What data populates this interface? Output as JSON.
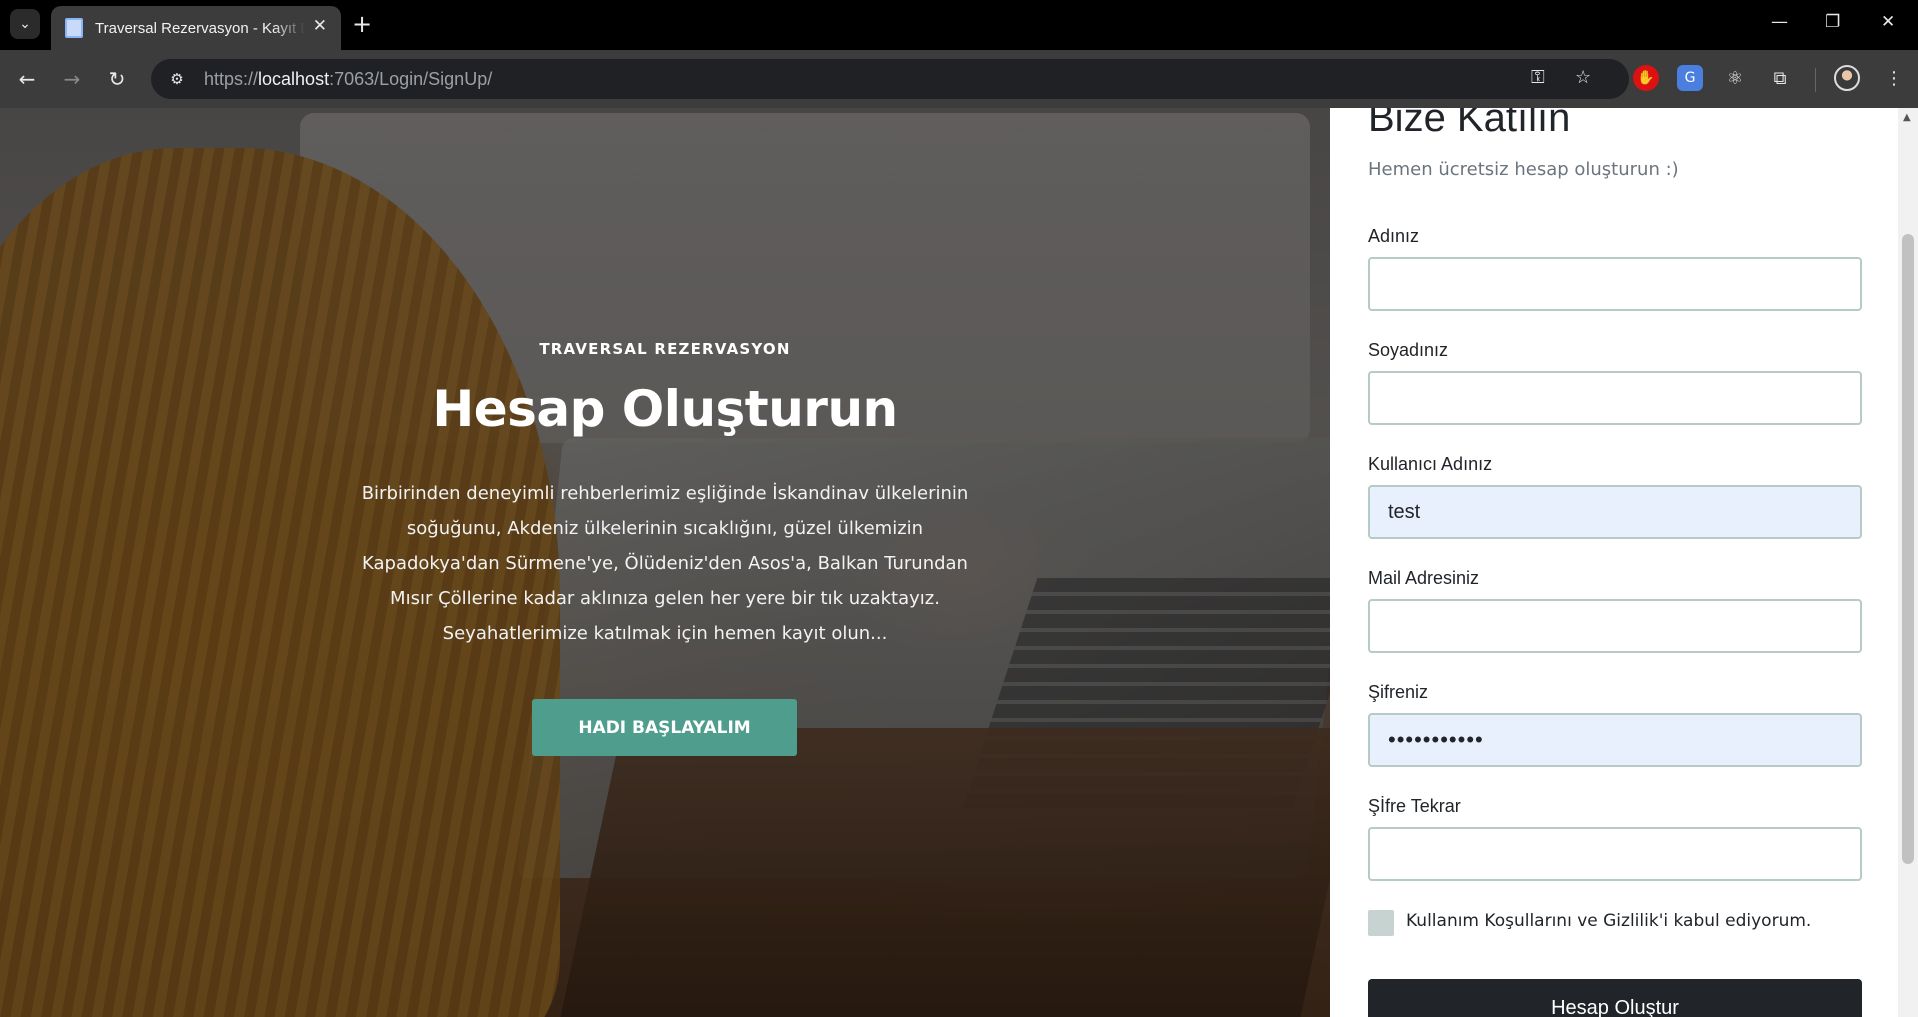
{
  "browser": {
    "tab_title": "Traversal Rezervasyon - Kayıt Ekle",
    "tab_close": "✕",
    "new_tab": "+",
    "url_prefix": "https://",
    "url_host": "localhost",
    "url_rest": ":7063/Login/SignUp/",
    "window": {
      "minimize": "—",
      "restore": "❐",
      "close": "✕"
    },
    "icons": [
      "tab-search-icon",
      "back-icon",
      "forward-icon",
      "reload-icon",
      "site-info-icon",
      "password-key-icon",
      "bookmark-star-icon",
      "extension-red-icon",
      "translate-icon",
      "react-devtools-icon",
      "extensions-puzzle-icon",
      "profile-avatar-icon",
      "menu-kebab-icon"
    ]
  },
  "hero": {
    "kicker": "TRAVERSAL REZERVASYON",
    "title": "Hesap Oluşturun",
    "description": "Birbirinden deneyimli rehberlerimiz eşliğinde İskandinav ülkelerinin soğuğunu, Akdeniz ülkelerinin sıcaklığını, güzel ülkemizin Kapadokya'dan Sürmene'ye, Ölüdeniz'den Asos'a, Balkan Turundan Mısır Çöllerine kadar aklınıza gelen her yere bir tık uzaktayız. Seyahatlerimize katılmak için hemen kayıt olun...",
    "button": "HADI BAŞLAYALIM"
  },
  "form": {
    "title": "Bize Katılın",
    "subtitle": "Hemen ücretsiz hesap oluşturun :)",
    "fields": [
      {
        "label": "Adınız",
        "value": ""
      },
      {
        "label": "Soyadınız",
        "value": ""
      },
      {
        "label": "Kullanıcı Adınız",
        "value": "test"
      },
      {
        "label": "Mail Adresiniz",
        "value": ""
      },
      {
        "label": "Şifreniz",
        "value": "•••••••••••"
      },
      {
        "label": "Şİfre Tekrar",
        "value": ""
      }
    ],
    "terms_label": "Kullanım Koşullarını ve Gizlilik'i kabul ediyorum.",
    "terms_checked": false,
    "submit": "Hesap Oluştur"
  },
  "colors": {
    "accent_button": "#4f9e8d",
    "submit_button": "#212529",
    "autofill_background": "#e8f0fe"
  }
}
